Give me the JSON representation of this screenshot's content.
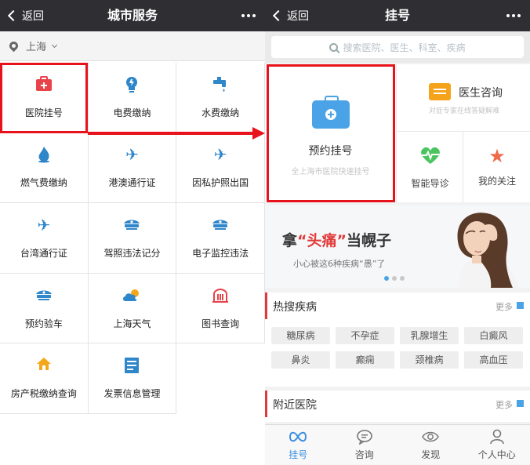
{
  "left_screen": {
    "back_label": "返回",
    "title": "城市服务",
    "location": "上海",
    "services": [
      {
        "label": "医院挂号",
        "icon": "hospital-kit-icon",
        "color": "#e8434a"
      },
      {
        "label": "电费缴纳",
        "icon": "lightbulb-icon",
        "color": "#2f86c9"
      },
      {
        "label": "水费缴纳",
        "icon": "water-tap-icon",
        "color": "#2f86c9"
      },
      {
        "label": "燃气费缴纳",
        "icon": "flame-icon",
        "color": "#2f86c9"
      },
      {
        "label": "港澳通行证",
        "icon": "airplane-icon",
        "color": "#2f86c9"
      },
      {
        "label": "因私护照出国",
        "icon": "airplane-icon",
        "color": "#2f86c9"
      },
      {
        "label": "台湾通行证",
        "icon": "airplane-icon",
        "color": "#2f86c9"
      },
      {
        "label": "驾照违法记分",
        "icon": "police-cap-icon",
        "color": "#2f86c9"
      },
      {
        "label": "电子监控违法",
        "icon": "police-cap-icon",
        "color": "#2f86c9"
      },
      {
        "label": "预约验车",
        "icon": "police-cap-icon",
        "color": "#2f86c9"
      },
      {
        "label": "上海天气",
        "icon": "weather-icon",
        "color": "#2f86c9"
      },
      {
        "label": "图书查询",
        "icon": "library-icon",
        "color": "#e8434a"
      },
      {
        "label": "房产税缴纳查询",
        "icon": "house-icon",
        "color": "#f3a81b"
      },
      {
        "label": "发票信息管理",
        "icon": "invoice-icon",
        "color": "#2f86c9"
      }
    ]
  },
  "right_screen": {
    "back_label": "返回",
    "title": "挂号",
    "search_placeholder": "搜索医院、医生、科室、疾病",
    "appointment": {
      "title": "预约挂号",
      "subtitle": "全上海市医院快速挂号"
    },
    "consult": {
      "title": "医生咨询",
      "subtitle": "对症专家在线答疑解难"
    },
    "guide": {
      "label": "智能导诊"
    },
    "follow": {
      "label": "我的关注"
    },
    "banner": {
      "title_prefix": "拿",
      "title_highlight": "“头痛”",
      "title_suffix": "当幌子",
      "subtitle": "小心被这6种疾病“愚”了"
    },
    "hot_diseases": {
      "title": "热搜疾病",
      "more": "更多",
      "items": [
        "糖尿病",
        "不孕症",
        "乳腺增生",
        "白癜风",
        "鼻炎",
        "癫痫",
        "颈椎病",
        "高血压"
      ]
    },
    "nearby": {
      "title": "附近医院",
      "more": "更多"
    },
    "tabs": [
      {
        "label": "挂号",
        "icon": "register-icon",
        "active": true
      },
      {
        "label": "咨询",
        "icon": "chat-bubble-icon",
        "active": false
      },
      {
        "label": "发现",
        "icon": "eye-icon",
        "active": false
      },
      {
        "label": "个人中心",
        "icon": "person-icon",
        "active": false
      }
    ]
  },
  "colors": {
    "highlight": "#e8121c",
    "accent_blue": "#3d8fe0",
    "navbar": "#2f2f33"
  }
}
